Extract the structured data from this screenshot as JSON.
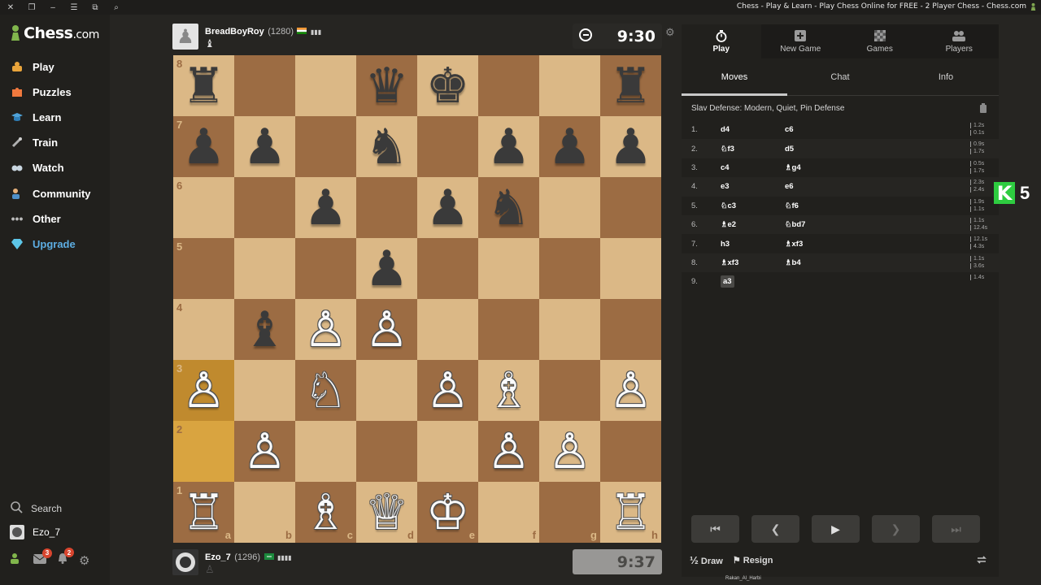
{
  "window": {
    "title": "Chess - Play & Learn - Play Chess Online for FREE - 2 Player Chess - Chess.com"
  },
  "sidebar": {
    "logo": "Chess",
    "logo_suffix": ".com",
    "items": [
      {
        "label": "Play",
        "icon": "play-icon"
      },
      {
        "label": "Puzzles",
        "icon": "puzzle-icon"
      },
      {
        "label": "Learn",
        "icon": "learn-icon"
      },
      {
        "label": "Train",
        "icon": "train-icon"
      },
      {
        "label": "Watch",
        "icon": "watch-icon"
      },
      {
        "label": "Community",
        "icon": "community-icon"
      },
      {
        "label": "Other",
        "icon": "more-icon"
      },
      {
        "label": "Upgrade",
        "icon": "diamond-icon"
      }
    ],
    "search": "Search",
    "user": "Ezo_7",
    "badges": {
      "messages": "3",
      "notifications": "2"
    }
  },
  "top_player": {
    "name": "BreadBoyRoy",
    "rating": "(1280)",
    "clock": "9:30"
  },
  "bottom_player": {
    "name": "Ezo_7",
    "rating": "(1296)",
    "clock": "9:37"
  },
  "board": {
    "ranks": [
      "8",
      "7",
      "6",
      "5",
      "4",
      "3",
      "2",
      "1"
    ],
    "files": [
      "a",
      "b",
      "c",
      "d",
      "e",
      "f",
      "g",
      "h"
    ],
    "squares": [
      [
        "♜",
        "",
        "",
        "♛",
        "♚",
        "",
        "",
        "♜"
      ],
      [
        "♟",
        "♟",
        "",
        "♞",
        "",
        "♟",
        "♟",
        "♟"
      ],
      [
        "",
        "",
        "♟",
        "",
        "♟",
        "♞",
        "",
        ""
      ],
      [
        "",
        "",
        "",
        "♟",
        "",
        "",
        "",
        ""
      ],
      [
        "",
        "♝",
        "♙",
        "♙",
        "",
        "",
        "",
        ""
      ],
      [
        "♙",
        "",
        "♘",
        "",
        "♙",
        "♗",
        "",
        "♙"
      ],
      [
        "",
        "♙",
        "",
        "",
        "",
        "♙",
        "♙",
        ""
      ],
      [
        "♖",
        "",
        "♗",
        "♕",
        "♔",
        "",
        "",
        "♖"
      ]
    ],
    "highlight": [
      "a3",
      "a2"
    ]
  },
  "panel": {
    "tabs": [
      {
        "label": "Play",
        "icon": "stopwatch-icon"
      },
      {
        "label": "New Game",
        "icon": "plus-icon"
      },
      {
        "label": "Games",
        "icon": "board-icon"
      },
      {
        "label": "Players",
        "icon": "players-icon"
      }
    ],
    "subtabs": [
      "Moves",
      "Chat",
      "Info"
    ],
    "opening": "Slav Defense: Modern, Quiet, Pin Defense",
    "moves": [
      {
        "n": "1.",
        "w": "d4",
        "b": "c6",
        "tw": "1.2s",
        "tb": "0.1s"
      },
      {
        "n": "2.",
        "w": "♘f3",
        "b": "d5",
        "tw": "0.9s",
        "tb": "1.7s"
      },
      {
        "n": "3.",
        "w": "c4",
        "b": "♗g4",
        "tw": "0.5s",
        "tb": "1.7s"
      },
      {
        "n": "4.",
        "w": "e3",
        "b": "e6",
        "tw": "2.3s",
        "tb": "2.4s"
      },
      {
        "n": "5.",
        "w": "♘c3",
        "b": "♘f6",
        "tw": "1.9s",
        "tb": "1.1s"
      },
      {
        "n": "6.",
        "w": "♗e2",
        "b": "♘bd7",
        "tw": "1.1s",
        "tb": "12.4s"
      },
      {
        "n": "7.",
        "w": "h3",
        "b": "♗xf3",
        "tw": "12.1s",
        "tb": "4.3s"
      },
      {
        "n": "8.",
        "w": "♗xf3",
        "b": "♗b4",
        "tw": "1.1s",
        "tb": "3.6s"
      },
      {
        "n": "9.",
        "w": "a3",
        "b": "",
        "tw": "1.4s",
        "tb": ""
      }
    ],
    "draw": "Draw",
    "resign": "Resign"
  },
  "overlay": {
    "letter": "K",
    "number": "5"
  },
  "footer": "Rakan_Al_Harbi"
}
